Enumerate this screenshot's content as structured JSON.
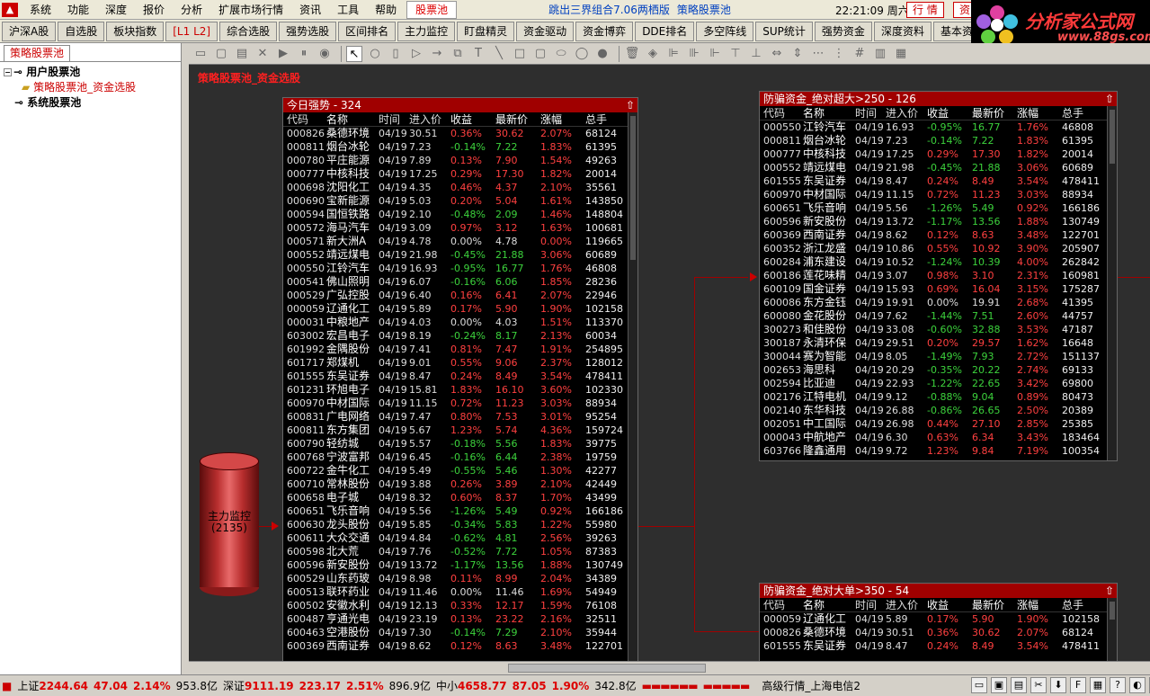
{
  "menubar": {
    "items": [
      "系统",
      "功能",
      "深度",
      "报价",
      "分析",
      "扩展市场行情",
      "资讯",
      "工具",
      "帮助"
    ],
    "active": "股票池",
    "window_title": "跳出三界组合7.06两栖版",
    "window_subtitle": "策略股票池",
    "clock": "22:21:09 周六",
    "btn_market": "行 情",
    "btn_info": "资"
  },
  "toolbar": {
    "buttons": [
      "沪深A股",
      "自选股",
      "板块指数",
      "[L1 L2]",
      "综合选股",
      "强势选股",
      "区间排名",
      "主力监控",
      "盯盘精灵",
      "资金驱动",
      "资金博弈",
      "DDE排名",
      "多空阵线",
      "SUP统计",
      "强势资金",
      "深度资料",
      "基本资料"
    ]
  },
  "brand": {
    "title": "分析家公式网",
    "url": "www.88gs.com"
  },
  "sidebar": {
    "tab": "策略股票池",
    "user_pool": "用户股票池",
    "selected_item": "策略股票池_资金选股",
    "system_pool": "系统股票池"
  },
  "pool_title": "策略股票池_资金选股",
  "headers": [
    "代码",
    "名称",
    "时间↓",
    "进入价",
    "收益",
    "最新价",
    "涨幅",
    "总手"
  ],
  "panels": {
    "strong": {
      "title": "今日强势 - 324",
      "rows": [
        [
          "000826",
          "桑德环境",
          "04/19",
          "30.51",
          "0.36%",
          "30.62",
          "2.07%",
          "68124"
        ],
        [
          "000811",
          "烟台冰轮",
          "04/19",
          "7.23",
          "-0.14%",
          "7.22",
          "1.83%",
          "61395"
        ],
        [
          "000780",
          "平庄能源",
          "04/19",
          "7.89",
          "0.13%",
          "7.90",
          "1.54%",
          "49263"
        ],
        [
          "000777",
          "中核科技",
          "04/19",
          "17.25",
          "0.29%",
          "17.30",
          "1.82%",
          "20014"
        ],
        [
          "000698",
          "沈阳化工",
          "04/19",
          "4.35",
          "0.46%",
          "4.37",
          "2.10%",
          "35561"
        ],
        [
          "000690",
          "宝新能源",
          "04/19",
          "5.03",
          "0.20%",
          "5.04",
          "1.61%",
          "143850"
        ],
        [
          "000594",
          "国恒铁路",
          "04/19",
          "2.10",
          "-0.48%",
          "2.09",
          "1.46%",
          "148804"
        ],
        [
          "000572",
          "海马汽车",
          "04/19",
          "3.09",
          "0.97%",
          "3.12",
          "1.63%",
          "100681"
        ],
        [
          "000571",
          "新大洲A",
          "04/19",
          "4.78",
          "0.00%",
          "4.78",
          "0.00%",
          "119665"
        ],
        [
          "000552",
          "靖远煤电",
          "04/19",
          "21.98",
          "-0.45%",
          "21.88",
          "3.06%",
          "60689"
        ],
        [
          "000550",
          "江铃汽车",
          "04/19",
          "16.93",
          "-0.95%",
          "16.77",
          "1.76%",
          "46808"
        ],
        [
          "000541",
          "佛山照明",
          "04/19",
          "6.07",
          "-0.16%",
          "6.06",
          "1.85%",
          "28236"
        ],
        [
          "000529",
          "广弘控股",
          "04/19",
          "6.40",
          "0.16%",
          "6.41",
          "2.07%",
          "22946"
        ],
        [
          "000059",
          "辽通化工",
          "04/19",
          "5.89",
          "0.17%",
          "5.90",
          "1.90%",
          "102158"
        ],
        [
          "000031",
          "中粮地产",
          "04/19",
          "4.03",
          "0.00%",
          "4.03",
          "1.51%",
          "113370"
        ],
        [
          "603002",
          "宏昌电子",
          "04/19",
          "8.19",
          "-0.24%",
          "8.17",
          "2.13%",
          "60034"
        ],
        [
          "601992",
          "金隅股份",
          "04/19",
          "7.41",
          "0.81%",
          "7.47",
          "1.91%",
          "254895"
        ],
        [
          "601717",
          "郑煤机",
          "04/19",
          "9.01",
          "0.55%",
          "9.06",
          "2.37%",
          "128012"
        ],
        [
          "601555",
          "东吴证券",
          "04/19",
          "8.47",
          "0.24%",
          "8.49",
          "3.54%",
          "478411"
        ],
        [
          "601231",
          "环旭电子",
          "04/19",
          "15.81",
          "1.83%",
          "16.10",
          "3.60%",
          "102330"
        ],
        [
          "600970",
          "中材国际",
          "04/19",
          "11.15",
          "0.72%",
          "11.23",
          "3.03%",
          "88934"
        ],
        [
          "600831",
          "广电网络",
          "04/19",
          "7.47",
          "0.80%",
          "7.53",
          "3.01%",
          "95254"
        ],
        [
          "600811",
          "东方集团",
          "04/19",
          "5.67",
          "1.23%",
          "5.74",
          "4.36%",
          "159724"
        ],
        [
          "600790",
          "轻纺城",
          "04/19",
          "5.57",
          "-0.18%",
          "5.56",
          "1.83%",
          "39775"
        ],
        [
          "600768",
          "宁波富邦",
          "04/19",
          "6.45",
          "-0.16%",
          "6.44",
          "2.38%",
          "19759"
        ],
        [
          "600722",
          "金牛化工",
          "04/19",
          "5.49",
          "-0.55%",
          "5.46",
          "1.30%",
          "42277"
        ],
        [
          "600710",
          "常林股份",
          "04/19",
          "3.88",
          "0.26%",
          "3.89",
          "2.10%",
          "42449"
        ],
        [
          "600658",
          "电子城",
          "04/19",
          "8.32",
          "0.60%",
          "8.37",
          "1.70%",
          "43499"
        ],
        [
          "600651",
          "飞乐音响",
          "04/19",
          "5.56",
          "-1.26%",
          "5.49",
          "0.92%",
          "166186"
        ],
        [
          "600630",
          "龙头股份",
          "04/19",
          "5.85",
          "-0.34%",
          "5.83",
          "1.22%",
          "55980"
        ],
        [
          "600611",
          "大众交通",
          "04/19",
          "4.84",
          "-0.62%",
          "4.81",
          "2.56%",
          "39263"
        ],
        [
          "600598",
          "北大荒",
          "04/19",
          "7.76",
          "-0.52%",
          "7.72",
          "1.05%",
          "87383"
        ],
        [
          "600596",
          "新安股份",
          "04/19",
          "13.72",
          "-1.17%",
          "13.56",
          "1.88%",
          "130749"
        ],
        [
          "600529",
          "山东药玻",
          "04/19",
          "8.98",
          "0.11%",
          "8.99",
          "2.04%",
          "34389"
        ],
        [
          "600513",
          "联环药业",
          "04/19",
          "11.46",
          "0.00%",
          "11.46",
          "1.69%",
          "54949"
        ],
        [
          "600502",
          "安徽水利",
          "04/19",
          "12.13",
          "0.33%",
          "12.17",
          "1.59%",
          "76108"
        ],
        [
          "600487",
          "亨通光电",
          "04/19",
          "23.19",
          "0.13%",
          "23.22",
          "2.16%",
          "32511"
        ],
        [
          "600463",
          "空港股份",
          "04/19",
          "7.30",
          "-0.14%",
          "7.29",
          "2.10%",
          "35944"
        ],
        [
          "600369",
          "西南证券",
          "04/19",
          "8.62",
          "0.12%",
          "8.63",
          "3.48%",
          "122701"
        ]
      ]
    },
    "super": {
      "title": "防骗资金_绝对超大>250 - 126",
      "rows": [
        [
          "000550",
          "江铃汽车",
          "04/19",
          "16.93",
          "-0.95%",
          "16.77",
          "1.76%",
          "46808"
        ],
        [
          "000811",
          "烟台冰轮",
          "04/19",
          "7.23",
          "-0.14%",
          "7.22",
          "1.83%",
          "61395"
        ],
        [
          "000777",
          "中核科技",
          "04/19",
          "17.25",
          "0.29%",
          "17.30",
          "1.82%",
          "20014"
        ],
        [
          "000552",
          "靖远煤电",
          "04/19",
          "21.98",
          "-0.45%",
          "21.88",
          "3.06%",
          "60689"
        ],
        [
          "601555",
          "东吴证券",
          "04/19",
          "8.47",
          "0.24%",
          "8.49",
          "3.54%",
          "478411"
        ],
        [
          "600970",
          "中材国际",
          "04/19",
          "11.15",
          "0.72%",
          "11.23",
          "3.03%",
          "88934"
        ],
        [
          "600651",
          "飞乐音响",
          "04/19",
          "5.56",
          "-1.26%",
          "5.49",
          "0.92%",
          "166186"
        ],
        [
          "600596",
          "新安股份",
          "04/19",
          "13.72",
          "-1.17%",
          "13.56",
          "1.88%",
          "130749"
        ],
        [
          "600369",
          "西南证券",
          "04/19",
          "8.62",
          "0.12%",
          "8.63",
          "3.48%",
          "122701"
        ],
        [
          "600352",
          "浙江龙盛",
          "04/19",
          "10.86",
          "0.55%",
          "10.92",
          "3.90%",
          "205907"
        ],
        [
          "600284",
          "浦东建设",
          "04/19",
          "10.52",
          "-1.24%",
          "10.39",
          "4.00%",
          "262842"
        ],
        [
          "600186",
          "莲花味精",
          "04/19",
          "3.07",
          "0.98%",
          "3.10",
          "2.31%",
          "160981"
        ],
        [
          "600109",
          "国金证券",
          "04/19",
          "15.93",
          "0.69%",
          "16.04",
          "3.15%",
          "175287"
        ],
        [
          "600086",
          "东方金钰",
          "04/19",
          "19.91",
          "0.00%",
          "19.91",
          "2.68%",
          "41395"
        ],
        [
          "600080",
          "金花股份",
          "04/19",
          "7.62",
          "-1.44%",
          "7.51",
          "2.60%",
          "44757"
        ],
        [
          "300273",
          "和佳股份",
          "04/19",
          "33.08",
          "-0.60%",
          "32.88",
          "3.53%",
          "47187"
        ],
        [
          "300187",
          "永清环保",
          "04/19",
          "29.51",
          "0.20%",
          "29.57",
          "1.62%",
          "16648"
        ],
        [
          "300044",
          "赛为智能",
          "04/19",
          "8.05",
          "-1.49%",
          "7.93",
          "2.72%",
          "151137"
        ],
        [
          "002653",
          "海思科",
          "04/19",
          "20.29",
          "-0.35%",
          "20.22",
          "2.74%",
          "69133"
        ],
        [
          "002594",
          "比亚迪",
          "04/19",
          "22.93",
          "-1.22%",
          "22.65",
          "3.42%",
          "69800"
        ],
        [
          "002176",
          "江特电机",
          "04/19",
          "9.12",
          "-0.88%",
          "9.04",
          "0.89%",
          "80473"
        ],
        [
          "002140",
          "东华科技",
          "04/19",
          "26.88",
          "-0.86%",
          "26.65",
          "2.50%",
          "20389"
        ],
        [
          "002051",
          "中工国际",
          "04/19",
          "26.98",
          "0.44%",
          "27.10",
          "2.85%",
          "25385"
        ],
        [
          "000043",
          "中航地产",
          "04/19",
          "6.30",
          "0.63%",
          "6.34",
          "3.43%",
          "183464"
        ],
        [
          "603766",
          "隆鑫通用",
          "04/19",
          "9.72",
          "1.23%",
          "9.84",
          "7.19%",
          "100354"
        ]
      ]
    },
    "large": {
      "title": "防骗资金_绝对大单>350 - 54",
      "rows": [
        [
          "000059",
          "辽通化工",
          "04/19",
          "5.89",
          "0.17%",
          "5.90",
          "1.90%",
          "102158"
        ],
        [
          "000826",
          "桑德环境",
          "04/19",
          "30.51",
          "0.36%",
          "30.62",
          "2.07%",
          "68124"
        ],
        [
          "601555",
          "东吴证券",
          "04/19",
          "8.47",
          "0.24%",
          "8.49",
          "3.54%",
          "478411"
        ]
      ]
    }
  },
  "monitor": {
    "label": "主力监控",
    "count": "(2135)"
  },
  "statusbar": {
    "sh_name": "上证",
    "sh_index": "2244.64",
    "sh_chg": "47.04",
    "sh_pct": "2.14%",
    "sh_amt": "953.8亿",
    "sz_name": "深证",
    "sz_index": "9111.19",
    "sz_chg": "223.17",
    "sz_pct": "2.51%",
    "sz_amt": "896.9亿",
    "zx_name": "中小",
    "zx_index": "4658.77",
    "zx_chg": "87.05",
    "zx_pct": "1.90%",
    "zx_amt": "342.8亿",
    "conn": "高级行情_上海电信2"
  }
}
